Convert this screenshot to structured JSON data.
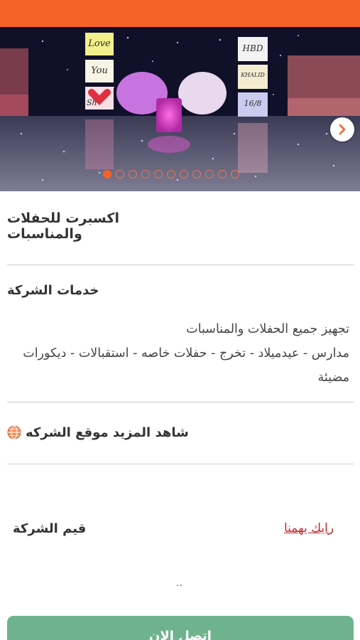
{
  "hero": {
    "cube_texts": [
      "Love",
      "You",
      "Sh",
      "HBD",
      "KHALID",
      "16/8"
    ],
    "slide_count": 11,
    "active_slide": 1,
    "next_icon": "chevron-right-icon"
  },
  "company": {
    "name": "اكسبرت للحفلات والمناسبات"
  },
  "services": {
    "title": "خدمات الشركة",
    "line1": "تجهيز جميع الحفلات والمناسبات",
    "line2": "مدارس - عيدميلاد - تخرج - حفلات خاصه - استقبالات - ديكورات مضيئة"
  },
  "website": {
    "label": "شاهد المزيد موقع الشركه",
    "icon": "globe-icon"
  },
  "rating": {
    "label": "قيم الشركة",
    "feedback_link": "رايك يهمنا",
    "dots": ".."
  },
  "contact": {
    "label": "اتصل الان"
  },
  "colors": {
    "accent": "#f4622a",
    "link": "#c0272d",
    "button": "#6fb38e",
    "divider": "#cfcfcf"
  }
}
